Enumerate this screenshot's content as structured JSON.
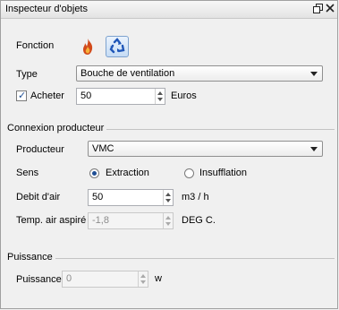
{
  "window": {
    "title": "Inspecteur d'objets"
  },
  "fonction": {
    "label": "Fonction",
    "icons": [
      "flame-icon",
      "recycle-icon"
    ]
  },
  "type": {
    "label": "Type",
    "value": "Bouche de ventilation"
  },
  "acheter": {
    "label": "Acheter",
    "checked": true,
    "value": "50",
    "unit": "Euros"
  },
  "connexion": {
    "section_title": "Connexion producteur",
    "producteur_label": "Producteur",
    "producteur_value": "VMC",
    "sens_label": "Sens",
    "sens_options": [
      "Extraction",
      "Insufflation"
    ],
    "sens_selected": "Extraction",
    "debit_label": "Debit d'air",
    "debit_value": "50",
    "debit_unit": "m3 / h",
    "temp_label": "Temp. air aspiré",
    "temp_value": "-1,8",
    "temp_unit": "DEG C."
  },
  "puissance": {
    "section_title": "Puissance",
    "label": "Puissance",
    "value": "0",
    "unit": "w"
  }
}
